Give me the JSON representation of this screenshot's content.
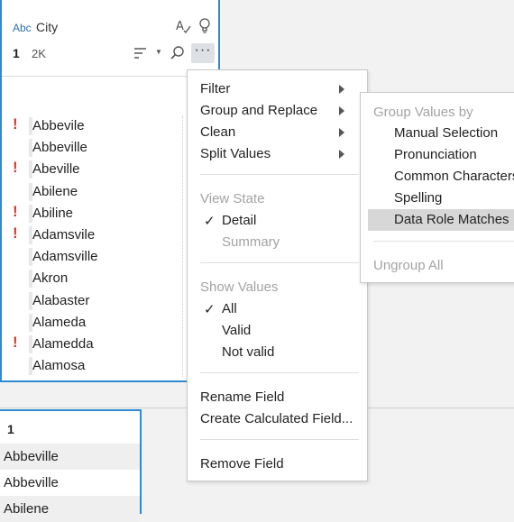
{
  "field_card": {
    "type_label": "Abc",
    "field_name": "City",
    "step_number": "1",
    "count": "2K",
    "more_label": "···",
    "values": [
      {
        "text": "Abbevile",
        "invalid": true
      },
      {
        "text": "Abbeville",
        "invalid": false
      },
      {
        "text": "Abeville",
        "invalid": true
      },
      {
        "text": "Abilene",
        "invalid": false
      },
      {
        "text": "Abiline",
        "invalid": true
      },
      {
        "text": "Adamsvile",
        "invalid": true
      },
      {
        "text": "Adamsville",
        "invalid": false
      },
      {
        "text": "Akron",
        "invalid": false
      },
      {
        "text": "Alabaster",
        "invalid": false
      },
      {
        "text": "Alameda",
        "invalid": false
      },
      {
        "text": "Alamedda",
        "invalid": true
      },
      {
        "text": "Alamosa",
        "invalid": false
      }
    ],
    "invalid_marker": "!"
  },
  "data_grid": {
    "header": "1",
    "rows": [
      "Abbeville",
      "Abbeville",
      "Abilene"
    ]
  },
  "context_menu": {
    "filter": "Filter",
    "group_replace": "Group and Replace",
    "clean": "Clean",
    "split_values": "Split Values",
    "view_state_header": "View State",
    "detail": "Detail",
    "summary": "Summary",
    "show_values_header": "Show Values",
    "all": "All",
    "valid": "Valid",
    "not_valid": "Not valid",
    "rename_field": "Rename Field",
    "create_calc": "Create Calculated Field...",
    "remove_field": "Remove Field",
    "checkmark": "✓"
  },
  "submenu": {
    "header": "Group Values by",
    "manual": "Manual Selection",
    "pronunciation": "Pronunciation",
    "common_chars": "Common Characters",
    "spelling": "Spelling",
    "data_role": "Data Role Matches",
    "ungroup": "Ungroup All"
  },
  "colors": {
    "accent": "#2f8ad1",
    "invalid": "#d93a2b",
    "highlight": "#d7d7d7"
  }
}
